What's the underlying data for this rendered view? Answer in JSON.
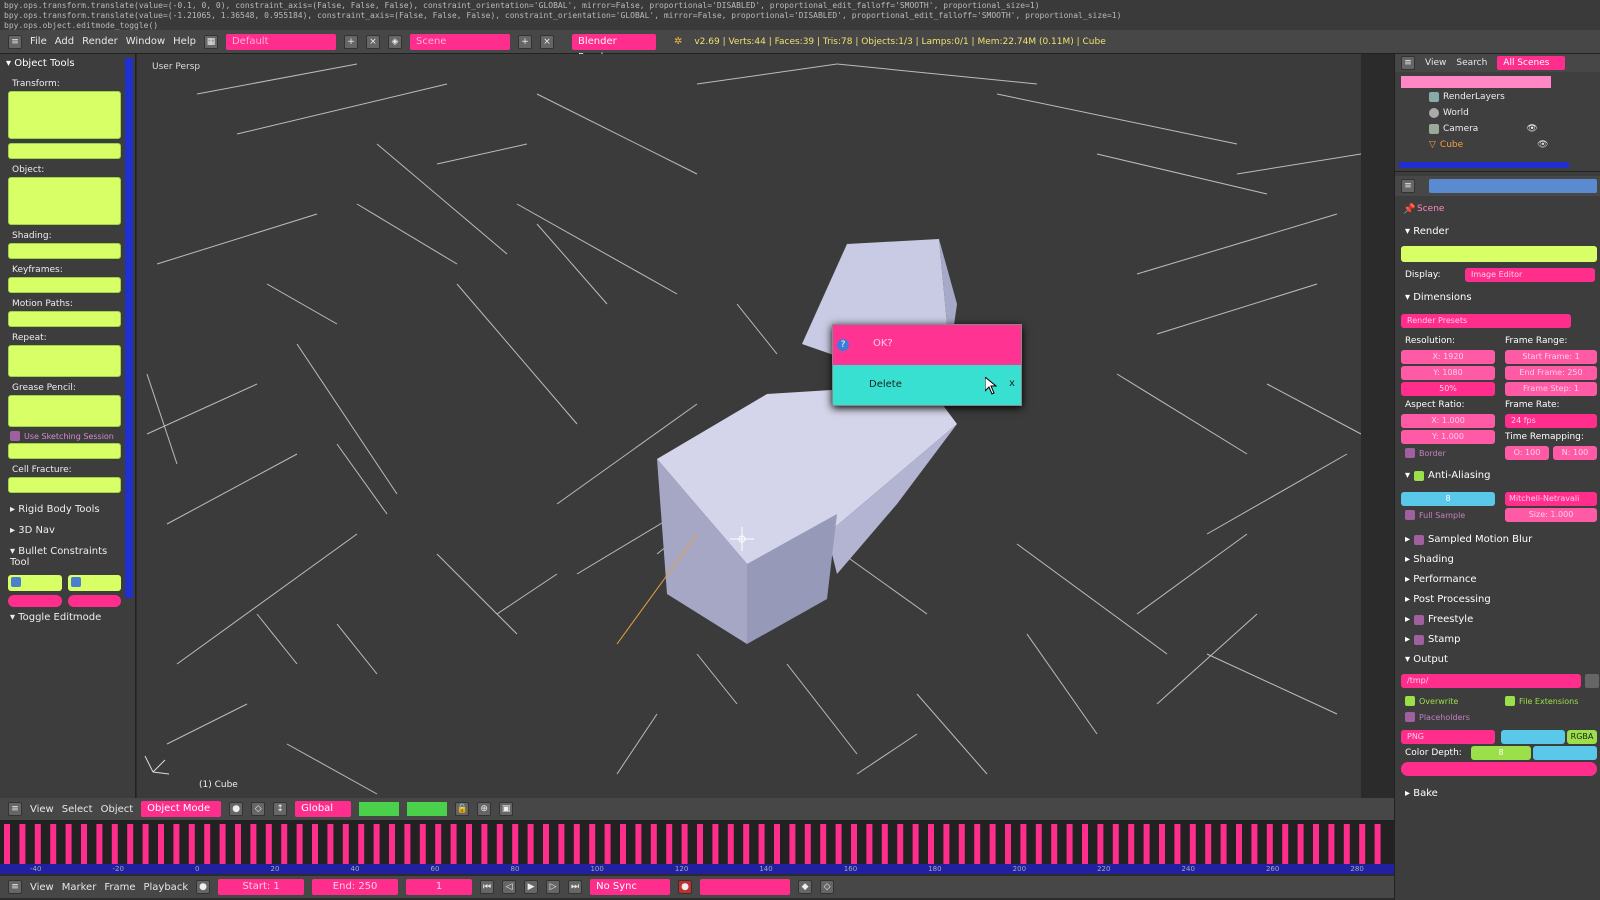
{
  "infobar": {
    "line1": "bpy.ops.transform.translate(value=(-0.1, 0, 0), constraint_axis=(False, False, False), constraint_orientation='GLOBAL', mirror=False, proportional='DISABLED', proportional_edit_falloff='SMOOTH', proportional_size=1)",
    "line2": "bpy.ops.transform.translate(value=(-1.21065, 1.36548, 0.955184), constraint_axis=(False, False, False), constraint_orientation='GLOBAL', mirror=False, proportional='DISABLED', proportional_edit_falloff='SMOOTH', proportional_size=1)",
    "line3": "bpy.ops.object.editmode_toggle()"
  },
  "topbar": {
    "menus": [
      "File",
      "Add",
      "Render",
      "Window",
      "Help"
    ],
    "layout": "Default",
    "scene": "Scene",
    "engine": "Blender Render",
    "stats": "v2.69 | Verts:44 | Faces:39 | Tris:78 | Objects:1/3 | Lamps:0/1 | Mem:22.74M (0.11M) | Cube"
  },
  "left": {
    "title": "Object Tools",
    "sections": [
      "Transform:",
      "Object:",
      "Shading:",
      "Keyframes:",
      "Motion Paths:",
      "Repeat:",
      "Grease Pencil:",
      "Cell Fracture:"
    ],
    "use_sketching": "Use Sketching Session",
    "rigid": "Rigid Body Tools",
    "nav": "3D Nav",
    "bullet": "Bullet Constraints Tool",
    "toggle": "Toggle Editmode"
  },
  "viewport": {
    "view_label": "User Persp",
    "object_label": "(1) Cube"
  },
  "dialog": {
    "title": "OK?",
    "action": "Delete",
    "close": "x"
  },
  "outliner": {
    "header": [
      "View",
      "Search",
      "All Scenes"
    ],
    "items": [
      "RenderLayers",
      "World",
      "Camera",
      "Cube"
    ]
  },
  "props": {
    "scene": "Scene",
    "render": "Render",
    "display_label": "Display:",
    "display_value": "Image Editor",
    "dimensions": "Dimensions",
    "presets": "Render Presets",
    "resolution": "Resolution:",
    "res_x": "X: 1920",
    "res_y": "Y: 1080",
    "res_pct": "50%",
    "frame_range": "Frame Range:",
    "start_frame": "Start Frame: 1",
    "end_frame": "End Frame: 250",
    "frame_step": "Frame Step: 1",
    "aspect": "Aspect Ratio:",
    "asp_x": "X: 1.000",
    "asp_y": "Y: 1.000",
    "frame_rate": "Frame Rate:",
    "fps": "24 fps",
    "time_remap": "Time Remapping:",
    "remap_old": "O: 100",
    "remap_new": "N: 100",
    "border": "Border",
    "aa": "Anti-Aliasing",
    "aa_samples": "8",
    "filter": "Mitchell-Netravali",
    "full_sample": "Full Sample",
    "size": "Size: 1.000",
    "collapsed": [
      "Sampled Motion Blur",
      "Shading",
      "Performance",
      "Post Processing",
      "Freestyle",
      "Stamp"
    ],
    "output": "Output",
    "path": "/tmp/",
    "overwrite": "Overwrite",
    "file_ext": "File Extensions",
    "placeholders": "Placeholders",
    "format": "PNG",
    "rgba": "RGBA",
    "color_depth": "Color Depth:",
    "depth": "8",
    "bake": "Bake"
  },
  "vpheader": {
    "menus": [
      "View",
      "Select",
      "Object"
    ],
    "mode": "Object Mode",
    "orientation": "Global"
  },
  "timeline": {
    "menus": [
      "View",
      "Marker",
      "Frame",
      "Playback"
    ],
    "start": "Start: 1",
    "end": "End: 250",
    "current": "1",
    "sync": "No Sync",
    "ticks": [
      "-40",
      "-20",
      "0",
      "20",
      "40",
      "60",
      "80",
      "100",
      "120",
      "140",
      "160",
      "180",
      "200",
      "220",
      "240",
      "260",
      "280"
    ]
  },
  "colors": {
    "pink": "#ff2d8c",
    "lime": "#d9ff66",
    "cyan": "#37e0d0",
    "blue": "#2030d0"
  }
}
